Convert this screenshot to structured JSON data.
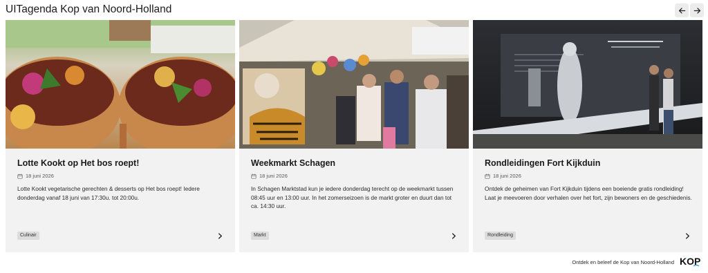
{
  "header": {
    "title": "UITagenda Kop van Noord-Holland",
    "prev_icon": "arrow-left-icon",
    "next_icon": "arrow-right-icon"
  },
  "cards": [
    {
      "title": "Lotte Kookt op Het bos roept!",
      "date": "18 juni 2026",
      "description": "Lotte Kookt vegetarische gerechten & desserts op Het bos roept! Iedere donderdag vanaf 18 juni van 17:30u. tot 20:00u.",
      "tag": "Culinair",
      "image": "food-bowls-photo"
    },
    {
      "title": "Weekmarkt Schagen",
      "date": "18 juni 2026",
      "description": "In Schagen Marktstad kun je iedere donderdag terecht op de weekmarkt tussen 08:45 uur en 13:00 uur. In het zomerseizoen is de markt groter en duurt dan tot ca. 14:30 uur.",
      "tag": "Markt",
      "image": "market-stall-photo"
    },
    {
      "title": "Rondleidingen Fort Kijkduin",
      "date": "18 juni 2026",
      "description": "Ontdek de geheimen van Fort Kijkduin tijdens een boeiende gratis rondleiding! Laat je meevoeren door verhalen over het fort, zijn bewoners en de geschiedenis.",
      "tag": "Rondleiding",
      "image": "museum-exhibit-photo"
    }
  ],
  "footer": {
    "text": "Ontdek en beleef de Kop van Noord-Holland",
    "logo_text": "KOP"
  },
  "colors": {
    "card_bg": "#f2f2f2",
    "tag_bg": "#dcdcdc",
    "nav_bg": "#ececec",
    "logo_accent": "#3aa7d8"
  }
}
